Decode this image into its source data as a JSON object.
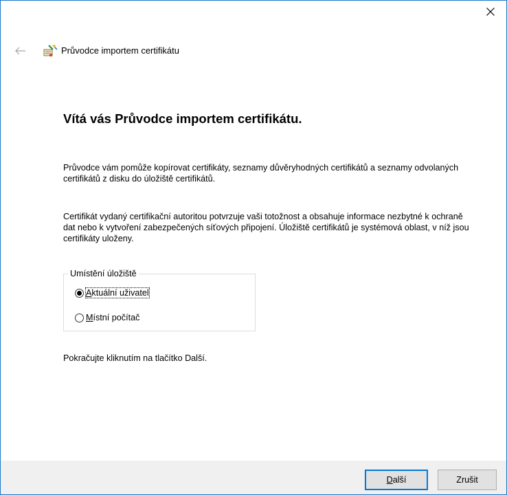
{
  "window": {
    "wizard_title": "Průvodce importem certifikátu",
    "heading": "Vítá vás Průvodce importem certifikátu.",
    "paragraph1": "Průvodce vám pomůže kopírovat certifikáty, seznamy důvěryhodných certifikátů a seznamy odvolaných certifikátů z disku do úložiště certifikátů.",
    "paragraph2": "Certifikát vydaný certifikační autoritou potvrzuje vaši totožnost a obsahuje informace nezbytné k ochraně dat nebo k vytvoření zabezpečených síťových připojení. Úložiště certifikátů je systémová oblast, v níž jsou certifikáty uloženy.",
    "continue_text": "Pokračujte kliknutím na tlačítko Další."
  },
  "icons": {
    "close": "close-icon",
    "back": "back-arrow-icon",
    "wizard": "certificate-wizard-icon"
  },
  "store_location": {
    "legend": "Umístění úložiště",
    "options": [
      {
        "label_accel": "A",
        "label_rest": "ktuální uživatel",
        "selected": true
      },
      {
        "label_accel": "M",
        "label_rest": "ístní počítač",
        "selected": false
      }
    ]
  },
  "buttons": {
    "next_accel": "D",
    "next_rest": "alší",
    "cancel": "Zrušit"
  },
  "colors": {
    "window_border": "#1979ca",
    "footer_bg": "#f0f0f0",
    "default_button_border": "#0078d7"
  }
}
